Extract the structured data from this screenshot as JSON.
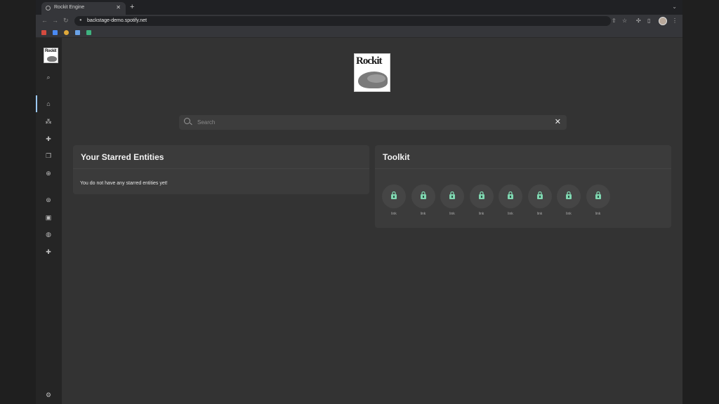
{
  "browser": {
    "tab_title": "Rockit Engine",
    "tab_close": "✕",
    "new_tab": "+",
    "url": "backstage-demo.spotify.net"
  },
  "brand": {
    "small_logo_text": "Rockit",
    "logo_text": "Rockit"
  },
  "search": {
    "placeholder": "Search",
    "clear": "✕"
  },
  "starred": {
    "title": "Your Starred Entities",
    "empty_message": "You do not have any starred entities yet!"
  },
  "toolkit": {
    "title": "Toolkit",
    "tools": [
      {
        "label": "link"
      },
      {
        "label": "link"
      },
      {
        "label": "link"
      },
      {
        "label": "link"
      },
      {
        "label": "link"
      },
      {
        "label": "link"
      },
      {
        "label": "link"
      },
      {
        "label": "link"
      }
    ]
  },
  "colors": {
    "tool_icon": "#7fd6b0",
    "sidebar_active": "#9cc9ff"
  }
}
